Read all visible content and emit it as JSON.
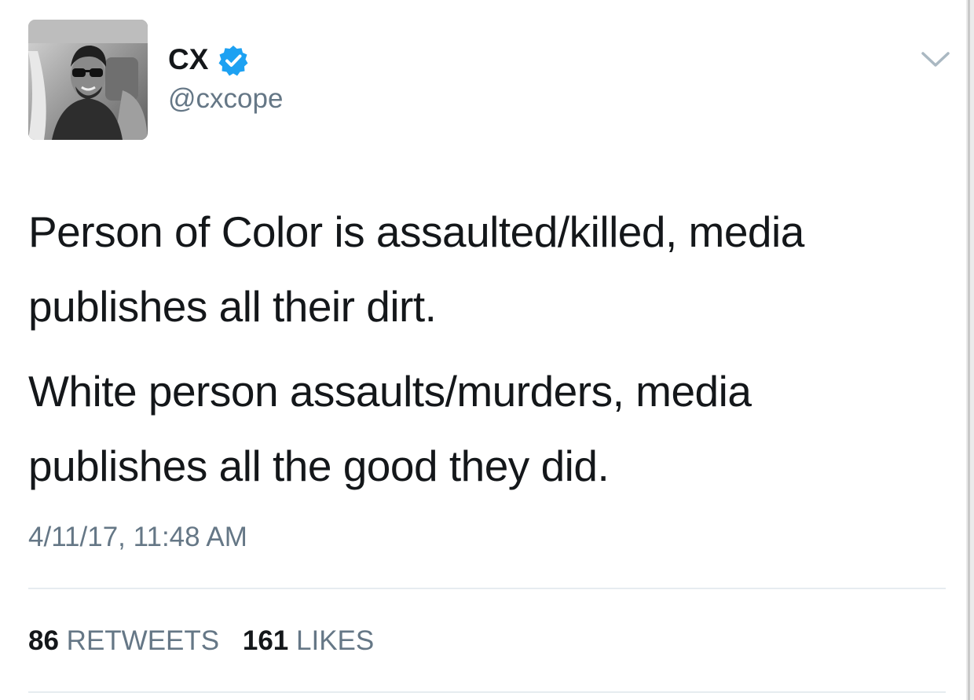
{
  "tweet": {
    "author": {
      "display_name": "CX",
      "handle": "@cxcope",
      "verified": true,
      "verified_color": "#1da1f2",
      "avatar_icon": "profile-photo"
    },
    "menu_icon": "chevron-down-icon",
    "text_paragraphs": [
      "Person of Color is assaulted/killed, media publishes all their dirt.",
      "White person assaults/murders, media publishes all the good they did."
    ],
    "timestamp": "4/11/17, 11:48 AM",
    "stats": {
      "retweets_count": "86",
      "retweets_label": "RETWEETS",
      "likes_count": "161",
      "likes_label": "LIKES"
    }
  }
}
